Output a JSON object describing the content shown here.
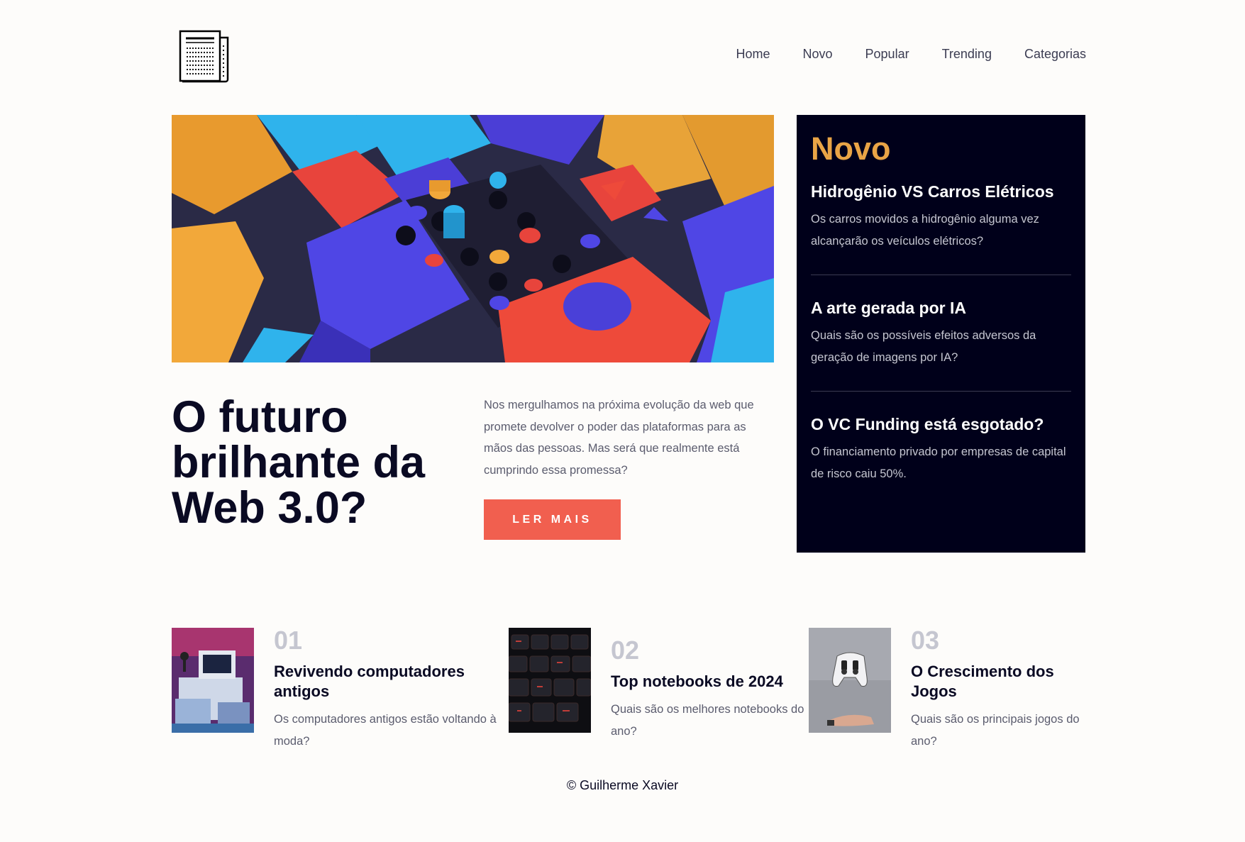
{
  "header": {
    "logo_icon": "newspaper-icon",
    "nav": [
      {
        "label": "Home"
      },
      {
        "label": "Novo"
      },
      {
        "label": "Popular"
      },
      {
        "label": "Trending"
      },
      {
        "label": "Categorias"
      }
    ]
  },
  "hero": {
    "title": "O futuro brilhante da Web 3.0?",
    "description": "Nos mergulhamos na próxima evolução da web que promete devolver o poder das plataformas para as mãos das pessoas. Mas será que realmente está cumprindo essa promessa?",
    "button_label": "LER MAIS",
    "image": "abstract-3d-blocks-image"
  },
  "sidebar": {
    "heading": "Novo",
    "items": [
      {
        "title": "Hidrogênio VS Carros Elétricos",
        "text": "Os carros movidos a hidrogênio alguma vez alcançarão os veículos elétricos?"
      },
      {
        "title": "A arte gerada por IA",
        "text": "Quais são os possíveis efeitos adversos da geração de imagens por IA?"
      },
      {
        "title": "O VC Funding está esgotado?",
        "text": "O financiamento privado por empresas de capital de risco caiu 50%."
      }
    ]
  },
  "articles": [
    {
      "num": "01",
      "title": "Revivendo computadores antigos",
      "text": "Os computadores antigos estão voltando à moda?"
    },
    {
      "num": "02",
      "title": "Top notebooks de 2024",
      "text": "Quais são os melhores notebooks do ano?"
    },
    {
      "num": "03",
      "title": "O Crescimento dos Jogos",
      "text": "Quais são os principais jogos do ano?"
    }
  ],
  "footer": {
    "text": "© Guilherme Xavier"
  },
  "colors": {
    "background": "#fdfcfa",
    "accent_button": "#f15f4f",
    "sidebar_bg": "#00001a",
    "sidebar_heading": "#e9a446",
    "text_dark": "#0a0a23",
    "text_muted": "#5b5c6e"
  }
}
